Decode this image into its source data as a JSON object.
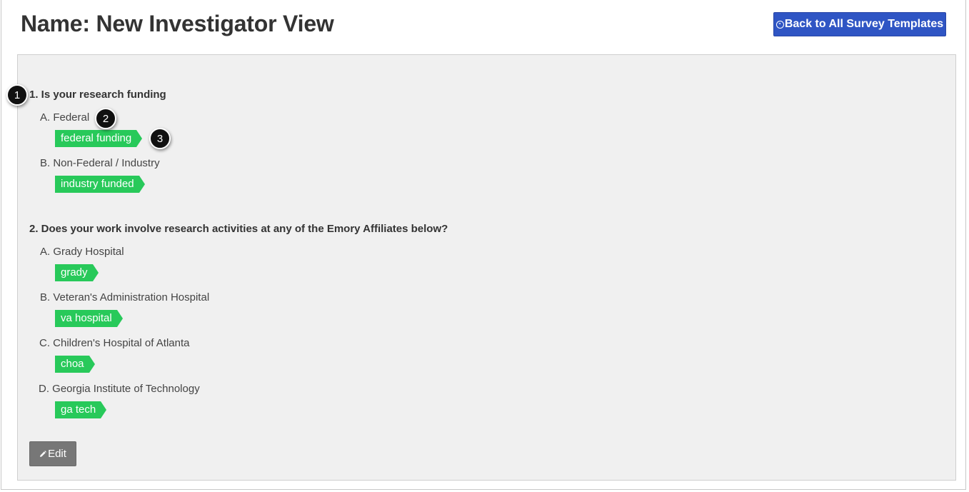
{
  "header": {
    "title": "Name: New Investigator View",
    "back_button_label": "Back to All Survey Templates",
    "back_button_icon": "circle-arrow-left-icon",
    "back_button_color": "#2f55c4"
  },
  "questions": [
    {
      "label": "1. Is your research funding",
      "answers": [
        {
          "label": "A. Federal",
          "tag": "federal funding"
        },
        {
          "label": "B. Non-Federal / Industry",
          "tag": "industry funded"
        }
      ]
    },
    {
      "label": "2. Does your work involve research activities at any of the Emory Affiliates below?",
      "answers": [
        {
          "label": "A. Grady Hospital",
          "tag": "grady"
        },
        {
          "label": "B. Veteran's Administration Hospital",
          "tag": "va hospital"
        },
        {
          "label": "C. Children's Hospital of Atlanta",
          "tag": "choa"
        },
        {
          "label": "D. Georgia Institute of Technology",
          "tag": "ga tech"
        }
      ]
    }
  ],
  "callouts": [
    "1",
    "2",
    "3"
  ],
  "edit_button": {
    "label": "Edit",
    "icon": "pencil-icon"
  },
  "colors": {
    "tag_green": "#28c95a",
    "panel_bg": "#f0f0f0",
    "edit_gray": "#777777"
  }
}
